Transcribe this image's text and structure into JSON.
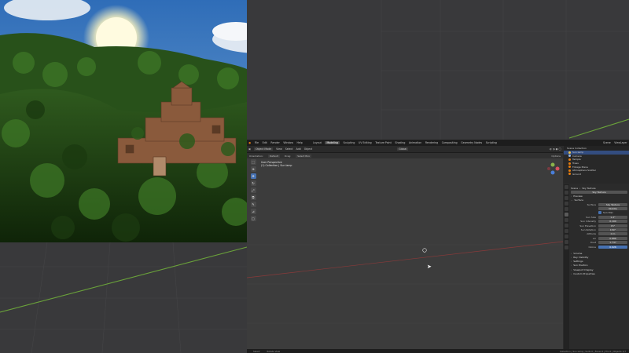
{
  "topbar": {
    "menus": [
      "File",
      "Edit",
      "Render",
      "Window",
      "Help"
    ],
    "workspaces": [
      "Layout",
      "Modeling",
      "Sculpting",
      "UV Editing",
      "Texture Paint",
      "Shading",
      "Animation",
      "Rendering",
      "Compositing",
      "Geometry Nodes",
      "Scripting"
    ],
    "active_workspace": "Modeling",
    "scene": "Scene",
    "view_layer": "ViewLayer"
  },
  "header": {
    "mode": "Object Mode",
    "items": [
      "View",
      "Select",
      "Add",
      "Object"
    ],
    "transform": "Global",
    "options": "Options"
  },
  "header2": {
    "orientation": "Orientation:",
    "default": "Default",
    "drag": "Drag:",
    "select_box": "Select Box"
  },
  "viewport": {
    "line1": "User Perspective",
    "line2": "(1) Collection | Sun lamp"
  },
  "outliner": {
    "title": "Scene Collection",
    "rows": [
      "Sun lamp",
      "Camera",
      "Temple",
      "Trees",
      "Foliage Plane",
      "Atmosphere Scatter",
      "Ground"
    ]
  },
  "properties": {
    "object": "Scene",
    "world": "Sky Texture",
    "sections": {
      "preview": "Preview",
      "surface": "Surface",
      "mist": "Mist Pass",
      "viewport_display": "Viewport Display",
      "settings": "Settings",
      "custom": "Custom Properties",
      "light_paths": "Ray Visibility",
      "volume": "Volume",
      "sun_position": "Sun Position"
    },
    "surface_type": "Sky Texture",
    "model": "Nishita",
    "sun_disc": "Sun Disc",
    "fields": [
      {
        "label": "Sun Size",
        "value": "1.2°"
      },
      {
        "label": "Sun Intensity",
        "value": "0.100"
      },
      {
        "label": "Sun Elevation",
        "value": "15°"
      },
      {
        "label": "Sun Rotation",
        "value": "150°"
      },
      {
        "label": "Altitude",
        "value": "0 m"
      },
      {
        "label": "Air",
        "value": "0.886"
      },
      {
        "label": "Dust",
        "value": "1.747"
      },
      {
        "label": "Ozone",
        "value": "0.926"
      }
    ]
  },
  "status": {
    "left": "Select",
    "middle": "Rotate View",
    "right": "Collection | Sun lamp | Verts 0 | Faces 0 | Tris 0 | Objects 1/7"
  },
  "colors": {
    "accent": "#4772b3",
    "axis_red": "#8a3a3a",
    "axis_green": "#6aa23a",
    "sky": "#3c7ac0"
  }
}
